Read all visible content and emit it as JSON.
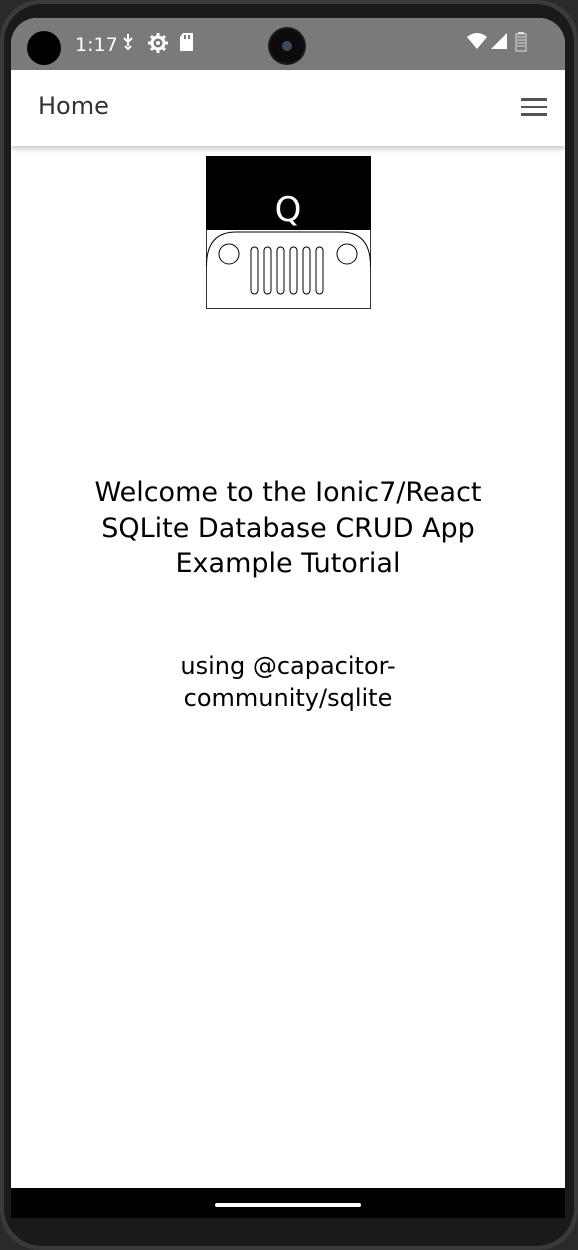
{
  "status_bar": {
    "time": "1:17",
    "icons": [
      "usb-debug-icon",
      "settings-gear-icon",
      "sd-card-icon",
      "wifi-icon",
      "cell-signal-icon",
      "battery-icon"
    ]
  },
  "toolbar": {
    "title": "Home",
    "menu_icon": "menu-hamburger-icon"
  },
  "logo": {
    "letter": "Q"
  },
  "main": {
    "welcome_text": "Welcome to the Ionic7/React SQLite Database CRUD App Example Tutorial",
    "subtitle_text": "using @capacitor-community/sqlite"
  },
  "colors": {
    "status_bar_bg": "#7a7a7a",
    "toolbar_bg": "#ffffff",
    "title_text": "#333333",
    "nav_bar_bg": "#000000"
  }
}
